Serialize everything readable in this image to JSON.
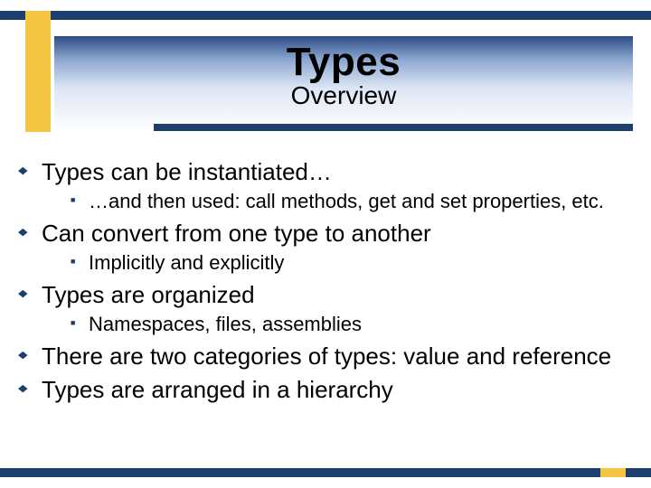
{
  "title": "Types",
  "subtitle": "Overview",
  "bullets": [
    {
      "level": 1,
      "text": "Types can be instantiated…"
    },
    {
      "level": 2,
      "text": "…and then used: call methods, get and set properties, etc."
    },
    {
      "level": 1,
      "text": "Can convert from one type to another"
    },
    {
      "level": 2,
      "text": "Implicitly and explicitly"
    },
    {
      "level": 1,
      "text": "Types are organized"
    },
    {
      "level": 2,
      "text": "Namespaces, files, assemblies"
    },
    {
      "level": 1,
      "text": "There are two categories of types: value and reference"
    },
    {
      "level": 1,
      "text": "Types are arranged in a hierarchy"
    }
  ],
  "colors": {
    "accent_navy": "#1c3f6e",
    "accent_gold": "#f4c542"
  }
}
